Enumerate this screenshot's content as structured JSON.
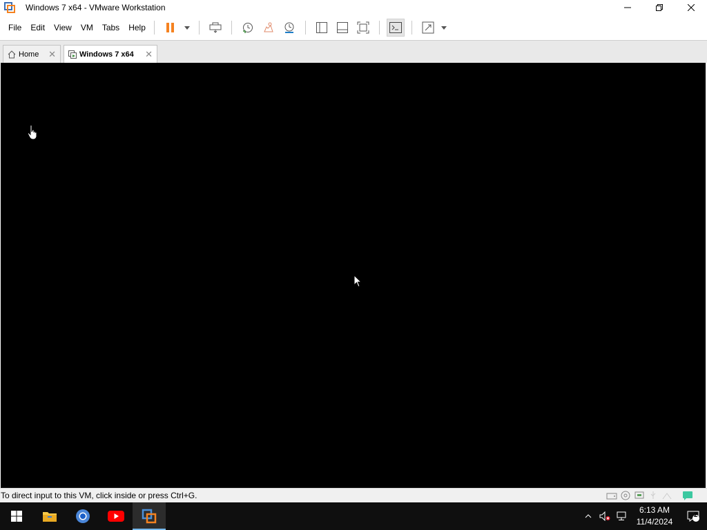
{
  "window": {
    "title": "Windows 7 x64 - VMware Workstation",
    "controls": [
      "minimize",
      "restore",
      "close"
    ]
  },
  "menu": {
    "items": [
      {
        "label": "File"
      },
      {
        "label": "Edit"
      },
      {
        "label": "View"
      },
      {
        "label": "VM"
      },
      {
        "label": "Tabs"
      },
      {
        "label": "Help"
      }
    ]
  },
  "toolbar": {
    "icons": [
      "pause-icon",
      "dropdown-icon",
      "send-ctrl-alt-del-icon",
      "snapshot-icon",
      "revert-snapshot-icon",
      "snapshot-manager-icon",
      "show-library-icon",
      "show-thumbnail-bar-icon",
      "full-screen-icon",
      "console-view-icon",
      "stretch-icon",
      "dropdown-icon"
    ]
  },
  "tabs": [
    {
      "label": "Home",
      "active": false
    },
    {
      "label": "Windows 7 x64",
      "active": true
    }
  ],
  "status": {
    "message": "To direct input to this VM, click inside or press Ctrl+G."
  },
  "taskbar": {
    "apps": [
      "start-icon",
      "file-explorer-icon",
      "chrome-icon",
      "youtube-icon",
      "vmware-icon"
    ],
    "time": "6:13 AM",
    "date": "11/4/2024",
    "notification_count": "2"
  },
  "colors": {
    "console": "#000000",
    "taskbar": "#0f0f0f",
    "accent_orange": "#f58220",
    "taskbar_active_line": "#76b9ed"
  }
}
